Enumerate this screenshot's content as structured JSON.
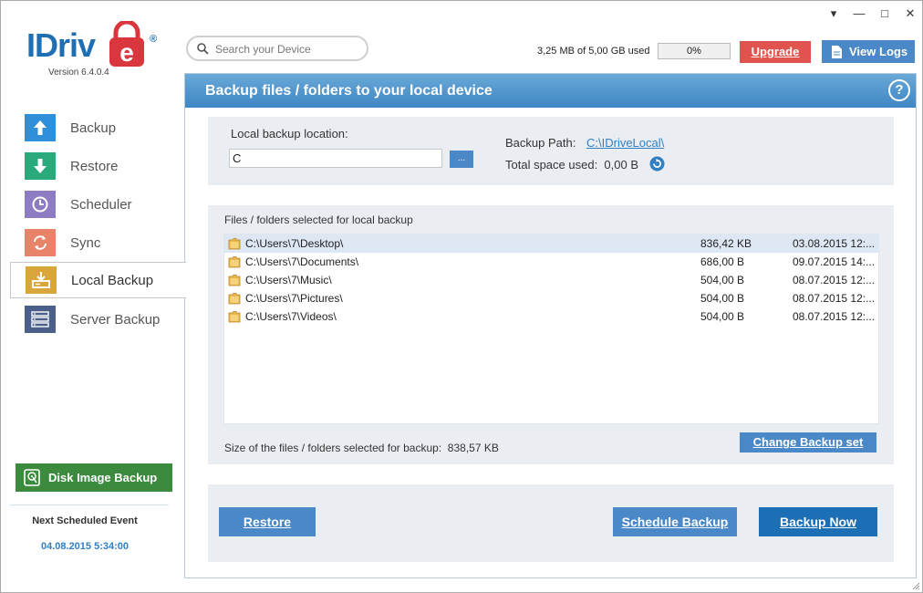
{
  "window": {
    "controls": [
      "▾",
      "—",
      "□",
      "✕"
    ]
  },
  "brand": {
    "logo_text": "IDriv",
    "logo_e": "e",
    "registered": "®",
    "version": "Version  6.4.0.4",
    "logo_color": "#1f6fb3",
    "logo_accent": "#d9363e"
  },
  "search": {
    "placeholder": "Search your Device",
    "icon": "search-icon"
  },
  "usage": {
    "text": "3,25 MB of 5,00 GB used",
    "percent_label": "0%",
    "percent": 0
  },
  "header_buttons": {
    "upgrade": "Upgrade",
    "view_logs": "View Logs"
  },
  "sidebar": {
    "items": [
      {
        "label": "Backup",
        "icon": "upload-arrow-icon",
        "color": "#2f8fd8"
      },
      {
        "label": "Restore",
        "icon": "download-arrow-icon",
        "color": "#2aa97a"
      },
      {
        "label": "Scheduler",
        "icon": "clock-icon",
        "color": "#8e7cc3"
      },
      {
        "label": "Sync",
        "icon": "sync-icon",
        "color": "#e8836a"
      },
      {
        "label": "Local Backup",
        "icon": "local-drive-icon",
        "color": "#d9a63b",
        "active": true
      },
      {
        "label": "Server Backup",
        "icon": "server-icon",
        "color": "#4a5f8a"
      }
    ],
    "disk_image_button": "Disk Image Backup",
    "next_event_label": "Next Scheduled Event",
    "next_event_time": "04.08.2015 5:34:00"
  },
  "main": {
    "title": "Backup files / folders to your local device",
    "help": "?",
    "location": {
      "label": "Local backup location:",
      "value": "C",
      "browse": "...",
      "backup_path_label": "Backup Path:",
      "backup_path": "C:\\IDriveLocal\\",
      "total_space_label": "Total space used:",
      "total_space": "0,00 B"
    },
    "files": {
      "title": "Files / folders selected for local backup",
      "rows": [
        {
          "name": "C:\\Users\\7\\Desktop\\",
          "size": "836,42 KB",
          "date": "03.08.2015 12:..."
        },
        {
          "name": "C:\\Users\\7\\Documents\\",
          "size": "686,00 B",
          "date": "09.07.2015 14:..."
        },
        {
          "name": "C:\\Users\\7\\Music\\",
          "size": "504,00 B",
          "date": "08.07.2015 12:..."
        },
        {
          "name": "C:\\Users\\7\\Pictures\\",
          "size": "504,00 B",
          "date": "08.07.2015 12:..."
        },
        {
          "name": "C:\\Users\\7\\Videos\\",
          "size": "504,00 B",
          "date": "08.07.2015 12:..."
        }
      ],
      "size_label": "Size of the files / folders selected for backup:",
      "size_value": "838,57 KB",
      "change_button": "Change Backup set"
    },
    "actions": {
      "restore": "Restore",
      "schedule": "Schedule Backup",
      "backup_now": "Backup Now"
    }
  }
}
